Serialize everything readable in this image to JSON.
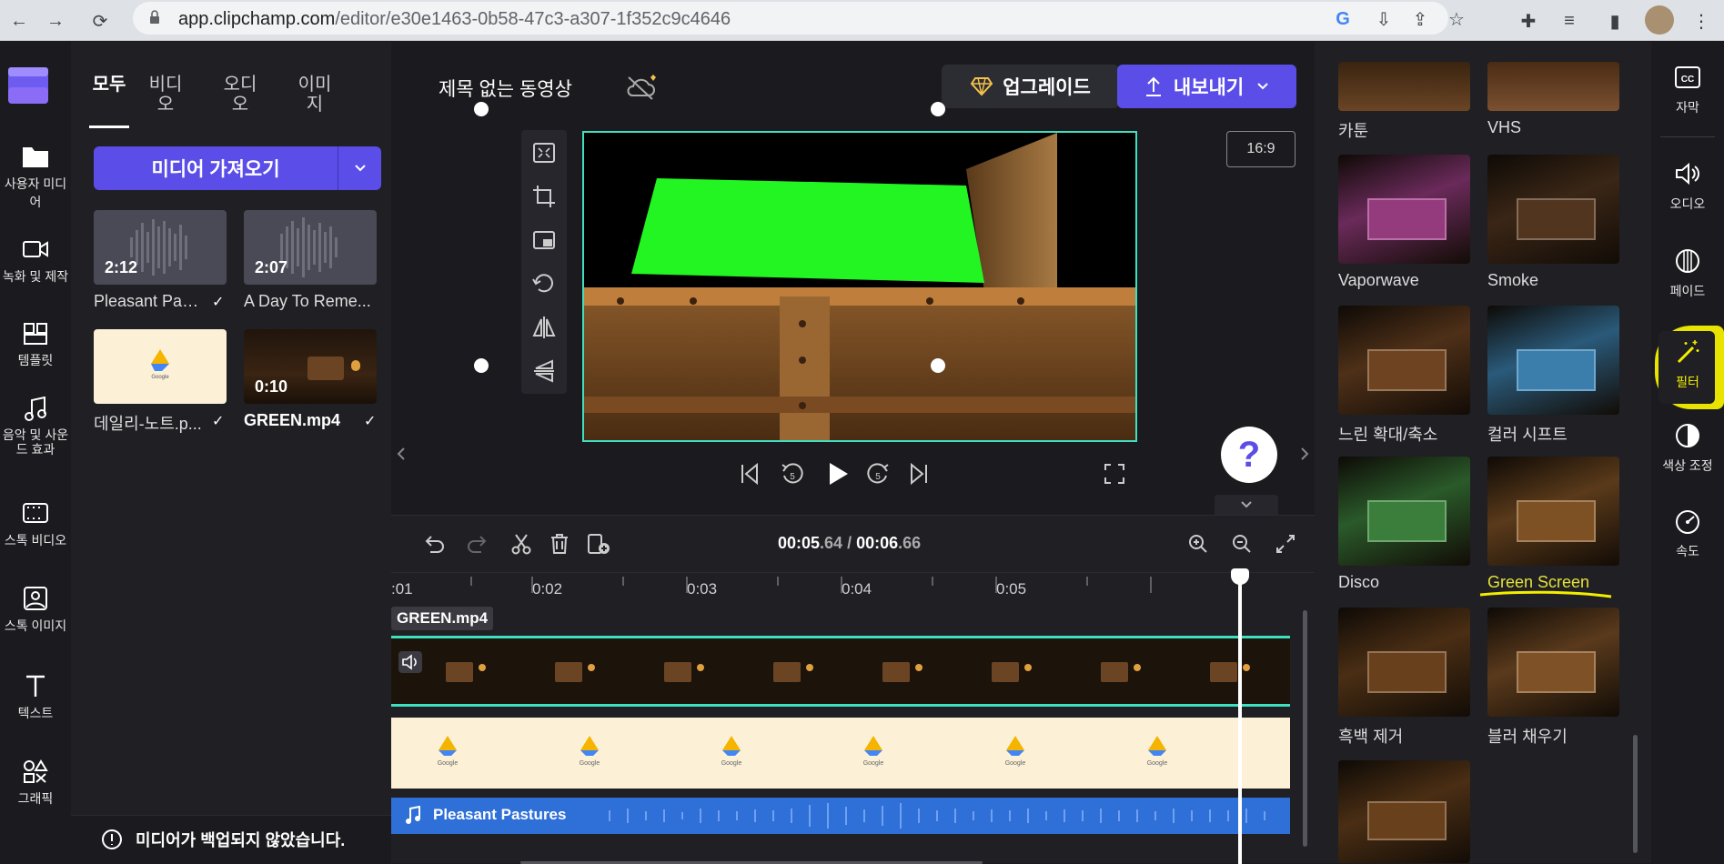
{
  "browser": {
    "url_host": "app.clipchamp.com",
    "url_path": "/editor/e30e1463-0b58-47c3-a307-1f352c9c4646"
  },
  "left_rail": {
    "items": [
      {
        "label": "사용자 미디어",
        "icon": "folder-icon"
      },
      {
        "label": "녹화 및 제작",
        "icon": "video-camera-icon"
      },
      {
        "label": "템플릿",
        "icon": "template-icon"
      },
      {
        "label": "음악 및 사운드 효과",
        "icon": "music-note-icon"
      },
      {
        "label": "스톡 비디오",
        "icon": "film-icon"
      },
      {
        "label": "스톡 이미지",
        "icon": "image-icon"
      },
      {
        "label": "텍스트",
        "icon": "text-icon"
      },
      {
        "label": "그래픽",
        "icon": "shapes-icon"
      }
    ]
  },
  "media": {
    "tabs": [
      "모두",
      "비디오",
      "오디오",
      "이미지"
    ],
    "import_label": "미디어 가져오기",
    "items": [
      {
        "name": "Pleasant Past...",
        "duration": "2:12",
        "type": "audio"
      },
      {
        "name": "A Day To Reme...",
        "duration": "2:07",
        "type": "audio"
      },
      {
        "name": "데일리-노트.p...",
        "duration": "",
        "type": "image"
      },
      {
        "name": "GREEN.mp4",
        "duration": "0:10",
        "type": "video"
      }
    ],
    "backup_warning": "미디어가 백업되지 않았습니다."
  },
  "preview": {
    "title": "제목 없는 동영상",
    "upgrade_label": "업그레이드",
    "export_label": "내보내기",
    "aspect_ratio": "16:9",
    "help_label": "?"
  },
  "timeline": {
    "current_time": "00:05",
    "current_ms": ".64",
    "separator": " / ",
    "total_time": "00:06",
    "total_ms": ".66",
    "ruler_ticks": [
      ":01",
      "0:02",
      "0:03",
      "0:04",
      "0:05"
    ],
    "clip_label": "GREEN.mp4",
    "audio_label": "Pleasant Pastures"
  },
  "filters": {
    "items": [
      {
        "label": "카툰",
        "tone": "#4a2a18"
      },
      {
        "label": "VHS",
        "tone": "#5a3a22"
      },
      {
        "label": "Vaporwave",
        "tone": "#6a2a5a"
      },
      {
        "label": "Smoke",
        "tone": "#3a2616"
      },
      {
        "label": "느린 확대/축소",
        "tone": "#4e3018"
      },
      {
        "label": "컬러 시프트",
        "tone": "#2a5a7a"
      },
      {
        "label": "Disco",
        "tone": "#2a5a2a"
      },
      {
        "label": "Green Screen",
        "tone": "#5a3a1a"
      },
      {
        "label": "흑백 제거",
        "tone": "#4a2e14"
      },
      {
        "label": "블러 채우기",
        "tone": "#5a3a1c"
      },
      {
        "label": "",
        "tone": "#4a2e14"
      }
    ]
  },
  "right_rail": {
    "items": [
      {
        "label": "자막",
        "icon": "cc-icon"
      },
      {
        "label": "오디오",
        "icon": "speaker-icon"
      },
      {
        "label": "페이드",
        "icon": "fade-icon"
      },
      {
        "label": "필터",
        "icon": "magic-wand-icon"
      },
      {
        "label": "색상 조정",
        "icon": "contrast-icon"
      },
      {
        "label": "속도",
        "icon": "speedometer-icon"
      }
    ]
  },
  "colors": {
    "accent": "#5b4ee8",
    "selection": "#3ee0c0",
    "highlight": "#f3ee00"
  }
}
